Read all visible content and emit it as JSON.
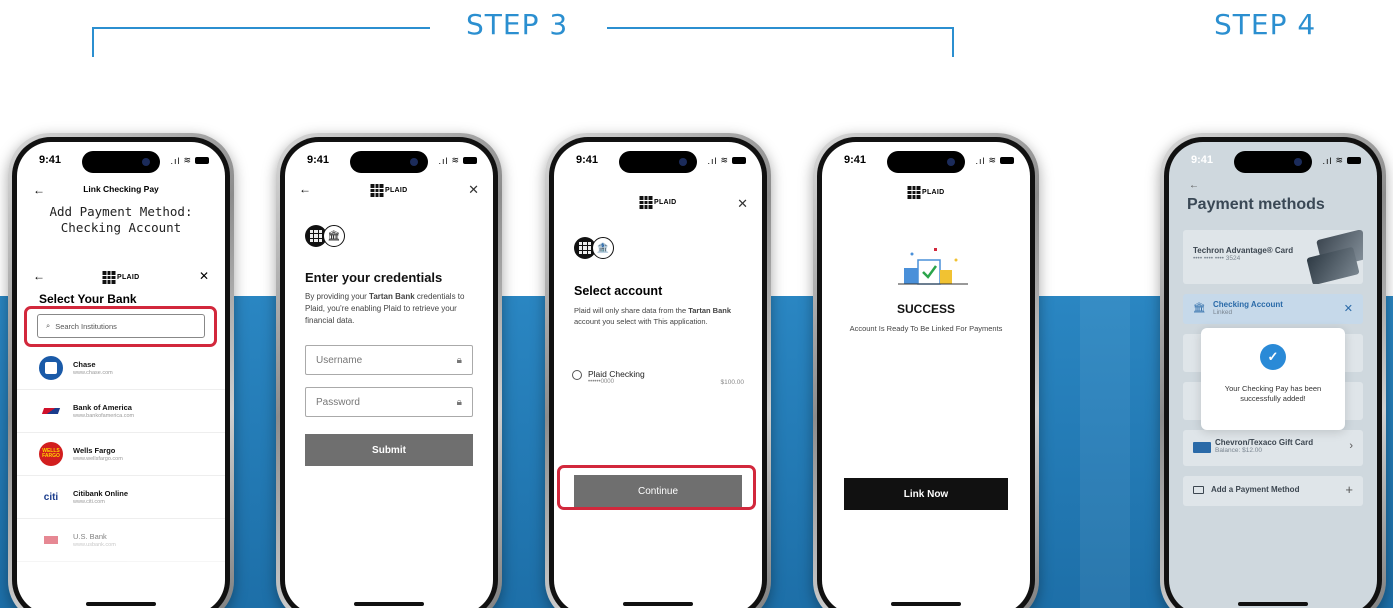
{
  "steps": {
    "step3": "STEP 3",
    "step4": "STEP 4"
  },
  "colors": {
    "accent": "#2b8fd0",
    "band": "#2a86c2",
    "highlight": "#d2283c"
  },
  "status_bar": {
    "time": "9:41"
  },
  "plaid": {
    "brand": "PLAID"
  },
  "phone1": {
    "nav_title": "Link Checking Pay",
    "heading": "Add Payment Method: Checking Account",
    "select_title": "Select Your Bank",
    "search_placeholder": "Search Institutions",
    "banks": [
      {
        "name": "Chase",
        "url": "www.chase.com",
        "logo_color": "#1a5aa8",
        "logo_text": ""
      },
      {
        "name": "Bank of America",
        "url": "www.bankofamerica.com",
        "logo_color": "#ffffff",
        "logo_text": ""
      },
      {
        "name": "Wells Fargo",
        "url": "www.wellsfargo.com",
        "logo_color": "#d21e1e",
        "logo_text": "WELLS FARGO"
      },
      {
        "name": "Citibank Online",
        "url": "www.citi.com",
        "logo_color": "#ffffff",
        "logo_text": "citi"
      },
      {
        "name": "U.S. Bank",
        "url": "www.usbank.com",
        "logo_color": "#ffffff",
        "logo_text": ""
      }
    ]
  },
  "phone2": {
    "heading": "Enter your credentials",
    "body_pre": "By providing your ",
    "body_bold": "Tartan Bank",
    "body_post": " credentials to Plaid, you're enabling Plaid to retrieve your financial data.",
    "username_placeholder": "Username",
    "password_placeholder": "Password",
    "submit_label": "Submit"
  },
  "phone3": {
    "heading": "Select account",
    "body_pre": "Plaid will only share data from the ",
    "body_bold": "Tartan Bank",
    "body_post": " account you select with This application.",
    "account_name": "Plaid Checking",
    "account_number": "••••••0000",
    "account_amount": "$100.00",
    "continue_label": "Continue"
  },
  "phone4": {
    "success_title": "SUCCESS",
    "success_body": "Account Is Ready To Be Linked For Payments",
    "link_label": "Link Now"
  },
  "phone5": {
    "title": "Payment methods",
    "card1_name": "Techron Advantage® Card",
    "card1_number": "•••• •••• •••• 3524",
    "card2_name": "Checking Account",
    "card2_status": "Linked",
    "card3_name": "Chevron/Texaco Gift Card",
    "card3_balance": "Balance: $12.00",
    "add_label": "Add a Payment Method",
    "toast_message": "Your Checking Pay has been successfully added!"
  }
}
